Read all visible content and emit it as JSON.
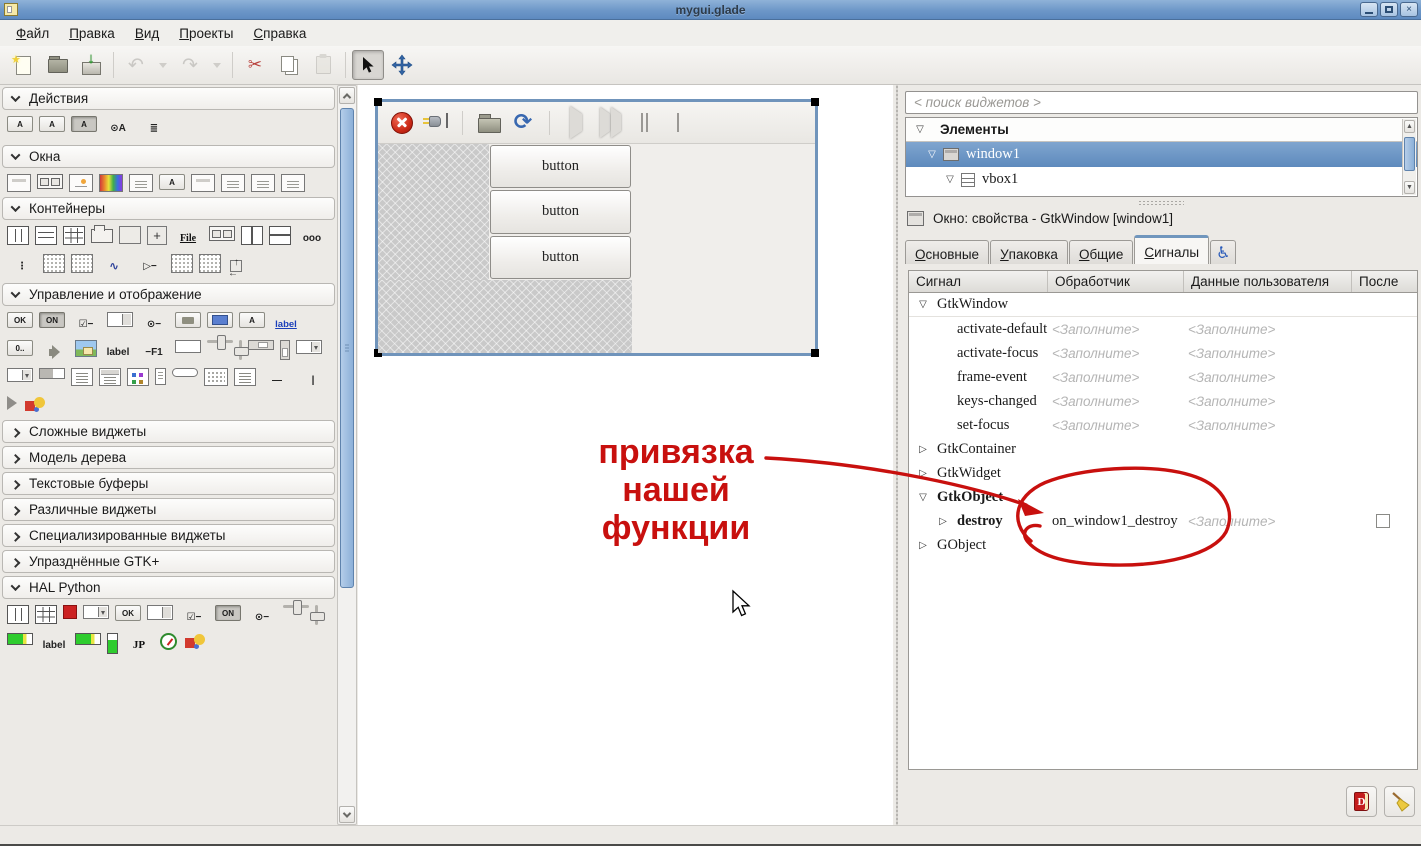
{
  "titlebar": {
    "title": "mygui.glade"
  },
  "menubar": {
    "items": [
      {
        "id": "file",
        "label": "Файл"
      },
      {
        "id": "edit",
        "label": "Правка"
      },
      {
        "id": "view",
        "label": "Вид"
      },
      {
        "id": "projects",
        "label": "Проекты"
      },
      {
        "id": "help",
        "label": "Справка"
      }
    ]
  },
  "toolbar": {
    "buttons": [
      {
        "id": "new"
      },
      {
        "id": "open"
      },
      {
        "id": "save"
      },
      {
        "sep": true
      },
      {
        "id": "undo",
        "disabled": true
      },
      {
        "id": "undo-menu",
        "disabled": true,
        "narrow": true
      },
      {
        "id": "redo",
        "disabled": true
      },
      {
        "id": "redo-menu",
        "disabled": true,
        "narrow": true
      },
      {
        "sep": true
      },
      {
        "id": "cut"
      },
      {
        "id": "copy"
      },
      {
        "id": "paste",
        "disabled": true
      },
      {
        "sep": true
      },
      {
        "id": "selector",
        "pressed": true
      },
      {
        "id": "drag-resize"
      }
    ]
  },
  "palette": {
    "sections": [
      {
        "id": "actions",
        "label": "Действия",
        "expanded": true,
        "icons": [
          [
            "action-group-icon",
            "b",
            "A"
          ],
          [
            "action-icon",
            "b",
            "A"
          ],
          [
            "toggle-action-icon",
            "p",
            "A"
          ],
          [
            "radio-action-icon",
            "x",
            "⊙A"
          ],
          [
            "action-list-icon",
            "x",
            "≣"
          ]
        ]
      },
      {
        "id": "windows",
        "label": "Окна",
        "expanded": true,
        "icons": [
          [
            "window-icon",
            "s",
            "win"
          ],
          [
            "dialog-icon",
            "s",
            "twobtn"
          ],
          [
            "about-dialog-icon",
            "s",
            "about"
          ],
          [
            "color-selection-dialog-icon",
            "s",
            "rainbow"
          ],
          [
            "file-chooser-dialog-icon",
            "s",
            "msg"
          ],
          [
            "font-selection-dialog-icon",
            "b",
            "A"
          ],
          [
            "input-dialog-icon",
            "s",
            "win"
          ],
          [
            "message-dialog-icon",
            "s",
            "msg"
          ],
          [
            "recent-chooser-dialog-icon",
            "s",
            "msg"
          ],
          [
            "assistant-icon",
            "s",
            "msg"
          ]
        ]
      },
      {
        "id": "containers",
        "label": "Контейнеры",
        "expanded": true,
        "icons": [
          [
            "hbox-icon",
            "s",
            "cols"
          ],
          [
            "vbox-icon",
            "s",
            "rows"
          ],
          [
            "table-icon",
            "s",
            "grid"
          ],
          [
            "notebook-icon",
            "s",
            "tab"
          ],
          [
            "frame-icon",
            "s",
            "box"
          ],
          [
            "fixed-icon",
            "s",
            "fixed"
          ],
          [
            "filechooser-widget-icon",
            "qu",
            "File"
          ],
          [
            "hbuttonbox-icon",
            "s",
            "twobtn"
          ],
          [
            "hpaned-icon",
            "s",
            "splitv"
          ],
          [
            "vpaned-icon",
            "s",
            "splith"
          ],
          [
            "toolbar-icon",
            "x",
            "ooo"
          ],
          [
            "vbuttonbox-icon",
            "x",
            "⋮"
          ],
          [
            "viewport-icon",
            "s",
            "dotbox"
          ],
          [
            "icon-factory-icon",
            "s",
            "dotbox"
          ],
          [
            "curve-icon",
            "xc",
            "∿"
          ],
          [
            "expander-icon",
            "x",
            "▷−"
          ],
          [
            "scrolledwindow-icon",
            "s",
            "dotbox"
          ],
          [
            "layout-icon",
            "s",
            "dotbox"
          ],
          [
            "alignment-icon",
            "s",
            "align"
          ]
        ]
      },
      {
        "id": "control-display",
        "label": "Управление и отображение",
        "expanded": true,
        "icons": [
          [
            "button-icon",
            "b",
            "OK"
          ],
          [
            "togglebutton-icon",
            "p",
            "ON"
          ],
          [
            "checkbutton-icon",
            "x",
            "☑−"
          ],
          [
            "spinbutton-icon",
            "s",
            "spin"
          ],
          [
            "radiobutton-icon",
            "x",
            "⊙−"
          ],
          [
            "filechooserbutton-icon",
            "s",
            "folderbtn"
          ],
          [
            "colorbutton-icon",
            "s",
            "colorbtn"
          ],
          [
            "fontbutton-icon",
            "b",
            "A"
          ],
          [
            "linkbutton-icon",
            "l",
            "label"
          ],
          [
            "scalebutton-icon",
            "b",
            "0.."
          ],
          [
            "volumebutton-icon",
            "s",
            "volume"
          ],
          [
            "image-icon",
            "s",
            "image"
          ],
          [
            "label-icon",
            "x",
            "label"
          ],
          [
            "accellabel-icon",
            "x",
            "−F1"
          ],
          [
            "entry-icon",
            "s",
            "entry"
          ],
          [
            "hscale-icon",
            "s",
            "hscale"
          ],
          [
            "vscale-icon",
            "s",
            "vscale"
          ],
          [
            "hscrollbar-icon",
            "s",
            "hscroll"
          ],
          [
            "vscrollbar-icon",
            "s",
            "vscroll"
          ],
          [
            "combobox-icon",
            "s",
            "combo"
          ],
          [
            "comboboxentry-icon",
            "s",
            "combo"
          ],
          [
            "progressbar-icon",
            "s",
            "progress"
          ],
          [
            "textview-icon",
            "s",
            "textview"
          ],
          [
            "treeview-icon",
            "s",
            "treeview"
          ],
          [
            "icon-view-icon",
            "s",
            "iconview"
          ],
          [
            "cellview-icon",
            "s",
            "cellview"
          ],
          [
            "statusbar-icon",
            "s",
            "pill"
          ],
          [
            "calendar-icon",
            "s",
            "calendar"
          ],
          [
            "list-icon",
            "s",
            "textview"
          ],
          [
            "hseparator-icon",
            "x",
            "—"
          ],
          [
            "vseparator-icon",
            "x",
            "|"
          ],
          [
            "arrow-icon",
            "s",
            "arrowr"
          ],
          [
            "drawingarea-icon",
            "s",
            "drawing"
          ]
        ]
      },
      {
        "id": "complex-widgets",
        "label": "Сложные виджеты",
        "expanded": false,
        "icons": []
      },
      {
        "id": "tree-model",
        "label": "Модель дерева",
        "expanded": false,
        "icons": []
      },
      {
        "id": "text-buffers",
        "label": "Текстовые буферы",
        "expanded": false,
        "icons": []
      },
      {
        "id": "misc-widgets",
        "label": "Различные виджеты",
        "expanded": false,
        "icons": []
      },
      {
        "id": "special-widgets",
        "label": "Специализированные виджеты",
        "expanded": false,
        "icons": []
      },
      {
        "id": "deprecated-gtk",
        "label": "Упразднённые GTK+",
        "expanded": false,
        "icons": []
      },
      {
        "id": "hal-python",
        "label": "HAL Python",
        "expanded": true,
        "icons": [
          [
            "hal-hbox-icon",
            "s",
            "cols"
          ],
          [
            "hal-table-icon",
            "s",
            "grid"
          ],
          [
            "hal-led-icon",
            "s",
            "led"
          ],
          [
            "hal-combobox-icon",
            "s",
            "combo"
          ],
          [
            "hal-button-icon",
            "b",
            "OK"
          ],
          [
            "hal-spinbutton-icon",
            "s",
            "spin"
          ],
          [
            "hal-checkbutton-icon",
            "x",
            "☑−"
          ],
          [
            "hal-togglebutton-icon",
            "p",
            "ON"
          ],
          [
            "hal-radiobutton-icon",
            "x",
            "⊙−"
          ],
          [
            "hal-hscale-icon",
            "s",
            "hscale"
          ],
          [
            "hal-vscale-icon",
            "s",
            "vscale"
          ],
          [
            "hal-progressbar-icon",
            "s",
            "hbar"
          ],
          [
            "hal-label-icon",
            "x",
            "label"
          ],
          [
            "hal-bar-icon",
            "s",
            "hbar"
          ],
          [
            "hal-meter-icon",
            "s",
            "vbar"
          ],
          [
            "hal-jogwheel-icon",
            "q",
            "JP"
          ],
          [
            "hal-gauge-icon",
            "s",
            "gauge"
          ],
          [
            "hal-graph-icon",
            "s",
            "drawing"
          ]
        ]
      }
    ]
  },
  "canvas": {
    "toolbar": [
      {
        "id": "close"
      },
      {
        "id": "connect"
      },
      {
        "sep": true
      },
      {
        "id": "open"
      },
      {
        "id": "refresh"
      },
      {
        "sep": true
      },
      {
        "id": "play"
      },
      {
        "id": "step"
      },
      {
        "id": "pause"
      },
      {
        "id": "stop"
      }
    ],
    "buttons": [
      "button",
      "button",
      "button"
    ]
  },
  "annotation": {
    "lines": [
      "привязка",
      "нашей",
      "функции"
    ],
    "color": "#c8100e"
  },
  "right": {
    "search_placeholder": "< поиск виджетов >",
    "tree": {
      "header": "Элементы",
      "rows": [
        {
          "label": "window1",
          "icon": "window",
          "selected": true
        },
        {
          "label": "vbox1",
          "icon": "vbox",
          "selected": false
        }
      ]
    },
    "props_title": "Окно: свойства - GtkWindow [window1]",
    "tabs": [
      {
        "id": "general",
        "label": "Основные",
        "active": false
      },
      {
        "id": "packing",
        "label": "Упаковка",
        "active": false
      },
      {
        "id": "common",
        "label": "Общие",
        "active": false
      },
      {
        "id": "signals",
        "label": "Сигналы",
        "active": true
      },
      {
        "id": "accessibility",
        "label": "",
        "icon": "wheelchair",
        "active": false
      }
    ],
    "signals": {
      "columns": [
        "Сигнал",
        "Обработчик",
        "Данные пользователя",
        "После"
      ],
      "placeholder": "<Заполните>",
      "rows": [
        {
          "kind": "class",
          "label": "GtkWindow",
          "expanded": true
        },
        {
          "kind": "signal",
          "label": "activate-default"
        },
        {
          "kind": "signal",
          "label": "activate-focus"
        },
        {
          "kind": "signal",
          "label": "frame-event"
        },
        {
          "kind": "signal",
          "label": "keys-changed"
        },
        {
          "kind": "signal",
          "label": "set-focus"
        },
        {
          "kind": "class",
          "label": "GtkContainer",
          "expanded": false
        },
        {
          "kind": "class",
          "label": "GtkWidget",
          "expanded": false
        },
        {
          "kind": "class",
          "label": "GtkObject",
          "expanded": true,
          "bold": true
        },
        {
          "kind": "signal",
          "label": "destroy",
          "bold": true,
          "expandable": true,
          "handler": "on_window1_destroy",
          "checkbox": true
        },
        {
          "kind": "class",
          "label": "GObject",
          "expanded": false
        }
      ]
    }
  },
  "colors": {
    "titlebar_blue": "#6d97c8",
    "selection_blue": "#6c96c6",
    "annotation_red": "#c8100e",
    "link_blue": "#1a3fba"
  }
}
